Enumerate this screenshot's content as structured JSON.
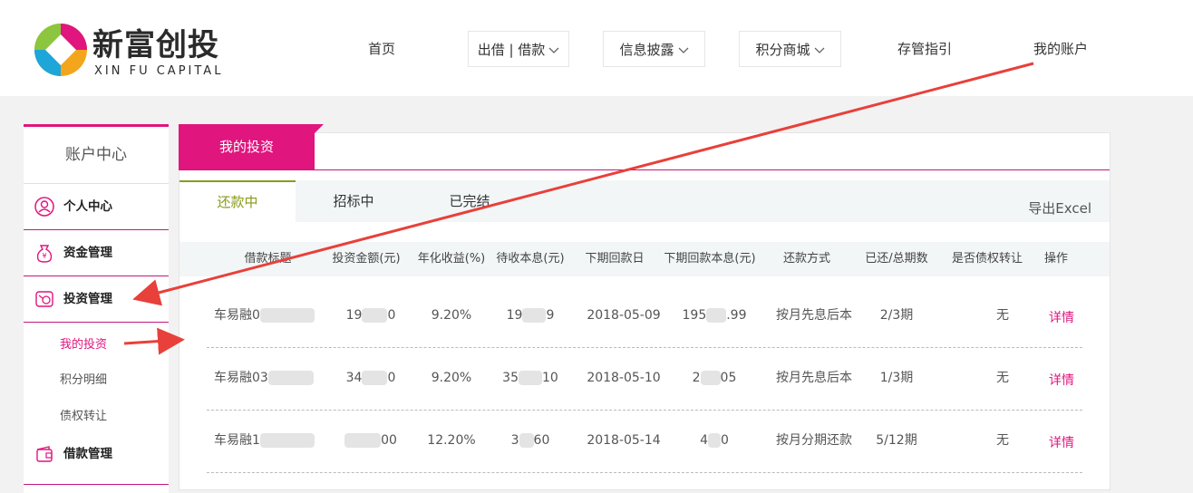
{
  "header": {
    "logo_cn": "新富创投",
    "logo_en": "XIN FU CAPITAL",
    "nav": [
      {
        "label": "首页",
        "dropdown": false
      },
      {
        "label": "出借 | 借款",
        "dropdown": true
      },
      {
        "label": "信息披露",
        "dropdown": true
      },
      {
        "label": "积分商城",
        "dropdown": true
      },
      {
        "label": "存管指引",
        "dropdown": false
      },
      {
        "label": "我的账户",
        "dropdown": false
      }
    ]
  },
  "sidebar": {
    "title": "账户中心",
    "items": [
      {
        "label": "个人中心",
        "icon": "person-icon"
      },
      {
        "label": "资金管理",
        "icon": "money-bag-icon"
      },
      {
        "label": "投资管理",
        "icon": "investment-icon"
      },
      {
        "label": "借款管理",
        "icon": "wallet-icon"
      }
    ],
    "sub_items": [
      {
        "label": "我的投资",
        "active": true
      },
      {
        "label": "积分明细",
        "active": false
      },
      {
        "label": "债权转让",
        "active": false
      }
    ]
  },
  "main": {
    "tab": "我的投资",
    "subtabs": [
      "还款中",
      "招标中",
      "已完结"
    ],
    "export": "导出Excel",
    "columns": [
      "借款标题",
      "投资金额(元)",
      "年化收益(%)",
      "待收本息(元)",
      "下期回款日",
      "下期回款本息(元)",
      "还款方式",
      "已还/总期数",
      "是否债权转让",
      "操作"
    ],
    "rows": [
      {
        "title": "车易融0",
        "amount": "19",
        "amount_tail": "0",
        "rate": "9.20%",
        "pending": "19",
        "pending_tail": "9",
        "date": "2018-05-09",
        "next": "195",
        "next_tail": ".99",
        "method": "按月先息后本",
        "periods": "2/3期",
        "transfer": "无",
        "action": "详情"
      },
      {
        "title": "车易融03",
        "amount": "34",
        "amount_tail": "0",
        "rate": "9.20%",
        "pending": "35",
        "pending_tail": "10",
        "date": "2018-05-10",
        "next": "2",
        "next_tail": "05",
        "method": "按月先息后本",
        "periods": "1/3期",
        "transfer": "无",
        "action": "详情"
      },
      {
        "title": "车易融1",
        "amount": "",
        "amount_tail": "00",
        "rate": "12.20%",
        "pending": "3",
        "pending_tail": "60",
        "date": "2018-05-14",
        "next": "4",
        "next_tail": "0",
        "method": "按月分期还款",
        "periods": "5/12期",
        "transfer": "无",
        "action": "详情"
      }
    ]
  },
  "colors": {
    "accent": "#e0157e",
    "arrow": "#e8403a",
    "active_subtab": "#8a9a1a"
  }
}
